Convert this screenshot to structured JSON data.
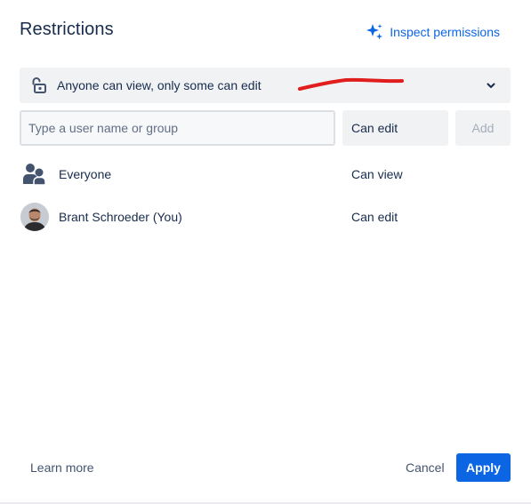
{
  "dialog": {
    "title": "Restrictions",
    "inspect_label": "Inspect permissions",
    "accent_color": "#0c66e4"
  },
  "restriction": {
    "icon": "unlock-icon",
    "selected_label": "Anyone can view, only some can edit",
    "annotation_color": "#e01e1e"
  },
  "add_user": {
    "placeholder": "Type a user name or group",
    "value": "",
    "permission_label": "Can edit",
    "add_label": "Add"
  },
  "entries": [
    {
      "icon": "people-group-icon",
      "name": "Everyone",
      "permission": "Can view"
    },
    {
      "icon": "user-avatar",
      "name": "Brant Schroeder (You)",
      "permission": "Can edit"
    }
  ],
  "footer": {
    "learn_more_label": "Learn more",
    "cancel_label": "Cancel",
    "apply_label": "Apply"
  }
}
